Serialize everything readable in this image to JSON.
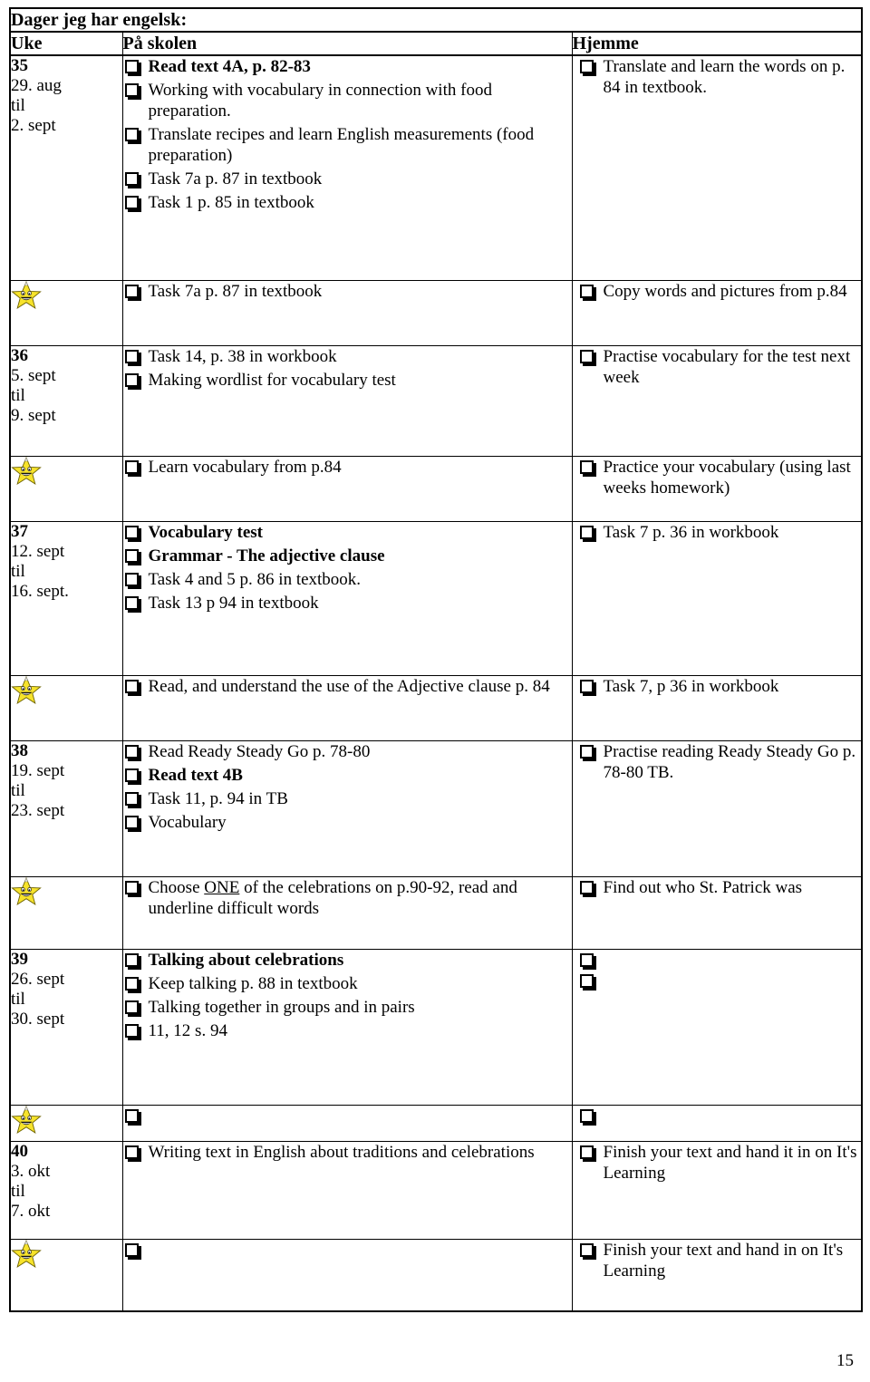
{
  "document": {
    "title": "Dager jeg har engelsk:",
    "page_number": "15"
  },
  "table": {
    "headers": {
      "week": "Uke",
      "school": "På skolen",
      "home": "Hjemme"
    },
    "star_icon": "smiling-star-icon",
    "rows": [
      {
        "type": "week",
        "week": {
          "number": "35",
          "from": "29. aug",
          "til": "til",
          "to": "2. sept"
        },
        "school": [
          {
            "text": "Read text 4A, p. 82-83",
            "bold": true
          },
          {
            "text": "Working with vocabulary in connection with food preparation.",
            "bold": false
          },
          {
            "text": "Translate recipes and learn English measurements (food preparation)",
            "bold": false
          },
          {
            "text": "Task 7a p. 87 in textbook",
            "bold": false
          },
          {
            "text": "Task 1 p. 85 in textbook",
            "bold": false
          }
        ],
        "home": [
          {
            "text": "Translate and learn the words on p. 84 in textbook.",
            "bold": false
          }
        ]
      },
      {
        "type": "star",
        "school": [
          {
            "text": "Task 7a p. 87 in textbook",
            "bold": false
          }
        ],
        "home": [
          {
            "text": "Copy words and pictures from p.84",
            "bold": false
          }
        ]
      },
      {
        "type": "week",
        "week": {
          "number": "36",
          "from": "5. sept",
          "til": "til",
          "to": "9. sept"
        },
        "school": [
          {
            "text": "Task 14, p. 38 in workbook",
            "bold": false
          },
          {
            "text": "Making wordlist for vocabulary test",
            "bold": false
          }
        ],
        "home": [
          {
            "text": "Practise vocabulary for the test next week",
            "bold": false
          }
        ]
      },
      {
        "type": "star",
        "school": [
          {
            "text": "Learn vocabulary from p.84",
            "bold": false
          }
        ],
        "home": [
          {
            "text": "Practice your vocabulary (using last weeks homework)",
            "bold": false
          }
        ]
      },
      {
        "type": "week",
        "week": {
          "number": "37",
          "from": "12. sept",
          "til": "til",
          "to": "16. sept."
        },
        "school": [
          {
            "text": "Vocabulary test",
            "bold": true
          },
          {
            "text": "Grammar - The adjective clause",
            "bold": true
          },
          {
            "text": "Task 4 and 5 p. 86 in textbook.",
            "bold": false
          },
          {
            "text": "Task 13 p 94 in textbook",
            "bold": false
          }
        ],
        "home": [
          {
            "text": "Task 7 p. 36 in workbook",
            "bold": false
          }
        ]
      },
      {
        "type": "star",
        "school": [
          {
            "text": "Read, and understand the use of the Adjective clause p. 84",
            "bold": false
          }
        ],
        "home": [
          {
            "text": "Task 7, p 36 in workbook",
            "bold": false
          }
        ]
      },
      {
        "type": "week",
        "week": {
          "number": "38",
          "from": "19. sept",
          "til": "til",
          "to": "23. sept"
        },
        "school": [
          {
            "text": "Read Ready Steady Go p. 78-80",
            "bold": false
          },
          {
            "text": "Read text 4B",
            "bold": true
          },
          {
            "text": "Task 11, p. 94 in TB",
            "bold": false
          },
          {
            "text": "Vocabulary",
            "bold": false
          }
        ],
        "home": [
          {
            "text": "Practise reading Ready Steady Go p. 78-80 TB.",
            "bold": false
          }
        ]
      },
      {
        "type": "star",
        "school": [
          {
            "text": "Choose ONE of the celebrations on p.90-92, read and underline difficult words",
            "bold": false,
            "underline_word": "ONE"
          }
        ],
        "home": [
          {
            "text": "Find out who St. Patrick was",
            "bold": false
          }
        ]
      },
      {
        "type": "week",
        "week": {
          "number": "39",
          "from": "26. sept",
          "til": "til",
          "to": "30. sept"
        },
        "school": [
          {
            "text": "Talking about celebrations",
            "bold": true
          },
          {
            "text": "Keep talking p. 88 in textbook",
            "bold": false
          },
          {
            "text": "Talking together in groups and in pairs",
            "bold": false
          },
          {
            "text": "11, 12 s. 94",
            "bold": false
          }
        ],
        "home": [
          {
            "text": "",
            "bold": false
          },
          {
            "text": "",
            "bold": false
          }
        ]
      },
      {
        "type": "star",
        "school": [
          {
            "text": "",
            "bold": false
          }
        ],
        "home": [
          {
            "text": "",
            "bold": false
          }
        ]
      },
      {
        "type": "week",
        "week": {
          "number": "40",
          "from": "3. okt",
          "til": "til",
          "to": "7. okt"
        },
        "school": [
          {
            "text": "Writing text in English about traditions and celebrations",
            "bold": false
          }
        ],
        "home": [
          {
            "text": "Finish your text and hand it in on It's Learning",
            "bold": false
          }
        ]
      },
      {
        "type": "star",
        "school": [
          {
            "text": "",
            "bold": false
          }
        ],
        "home": [
          {
            "text": "Finish your text and hand in on It's Learning",
            "bold": false
          }
        ]
      }
    ]
  }
}
